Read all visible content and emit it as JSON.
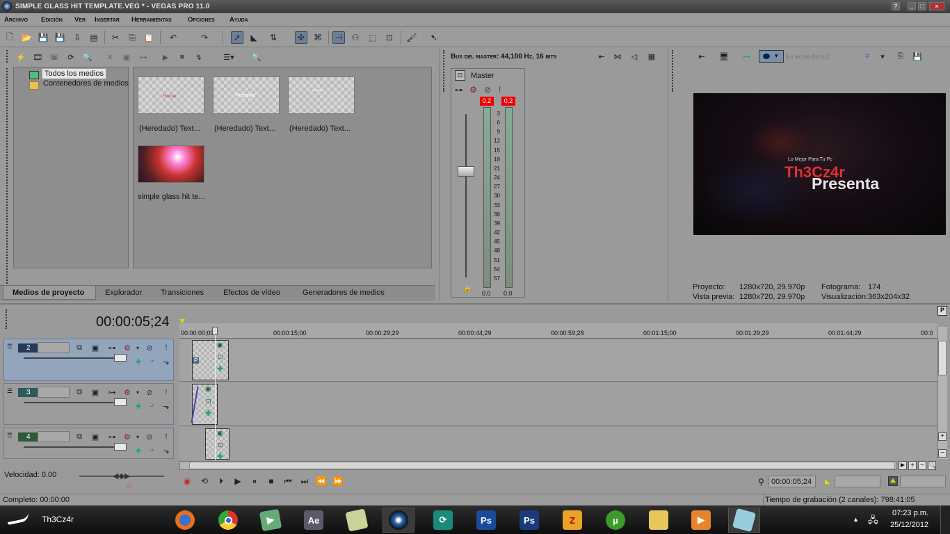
{
  "window": {
    "title": "SIMPLE GLASS HIT TEMPLATE.VEG * - VEGAS PRO 11.0"
  },
  "menu": [
    "Archivo",
    "Edición",
    "Ver",
    "Insertar",
    "Herramientas",
    "Opciones",
    "Ayuda"
  ],
  "media": {
    "tree": [
      "Todos los medios",
      "Contenedores de medios"
    ],
    "items": [
      {
        "caption": "(Heredado) Text...",
        "preview_text": "Th3Cz4r"
      },
      {
        "caption": "(Heredado) Text...",
        "preview_text": "Presenta"
      },
      {
        "caption": "(Heredado) Text...",
        "preview_text": "Lo Mejor..."
      },
      {
        "caption": "simple glass hit te..."
      }
    ],
    "tabs": [
      "Medios de proyecto",
      "Explorador",
      "Transiciones",
      "Efectos de vídeo",
      "Generadores de medios"
    ]
  },
  "mixer": {
    "header": "Bus del master: 44,100 Hz, 16 bits",
    "master_label": "Master",
    "peak_left": "0.2",
    "peak_right": "0.2",
    "scale": [
      "3",
      "6",
      "9",
      "12",
      "15",
      "18",
      "21",
      "24",
      "27",
      "30",
      "33",
      "36",
      "39",
      "42",
      "45",
      "48",
      "51",
      "54",
      "57"
    ],
    "bottom_left": "0.0",
    "bottom_right": "0.0"
  },
  "preview": {
    "quality": "La mejor (total)",
    "frame_text_small": "Lo Mejor Para Tu Pc",
    "frame_text_red": "Th3Cz4r",
    "frame_text_white": "Presenta",
    "info": {
      "proyecto_label": "Proyecto:",
      "proyecto": "1280x720, 29.970p",
      "vista_label": "Vista previa:",
      "vista": "1280x720, 29.970p",
      "fotograma_label": "Fotograma:",
      "fotograma": "174",
      "visualizacion_label": "Visualización:",
      "visualizacion": "363x204x32"
    }
  },
  "timeline": {
    "timecode": "00:00:05;24",
    "ruler": [
      "00:00:00;00",
      "00:00:15;00",
      "00:00:29;29",
      "00:00:44;29",
      "00:00:59;28",
      "00:01:15;00",
      "00:01:29;29",
      "00:01:44;29",
      "00:0"
    ],
    "tracks": [
      {
        "number": "2"
      },
      {
        "number": "3"
      },
      {
        "number": "4"
      }
    ],
    "velocidad": "Velocidad: 0.00",
    "cursor_time": "00:00:05;24"
  },
  "status": {
    "left": "Completo: 00:00:00",
    "right": "Tiempo de grabación (2 canales): 798:41:05"
  },
  "taskbar": {
    "user": "Th3Cz4r",
    "time": "07:23 p.m.",
    "date": "25/12/2012",
    "apps": [
      "firefox-icon",
      "chrome-icon",
      "camtasia-icon",
      "after-effects-icon",
      "notes-icon",
      "vegas-icon",
      "greenshot-icon",
      "photoshop-icon",
      "photoshop-icon",
      "filezilla-icon",
      "utorrent-icon",
      "explorer-icon",
      "media-player-icon",
      "paint-icon"
    ]
  }
}
